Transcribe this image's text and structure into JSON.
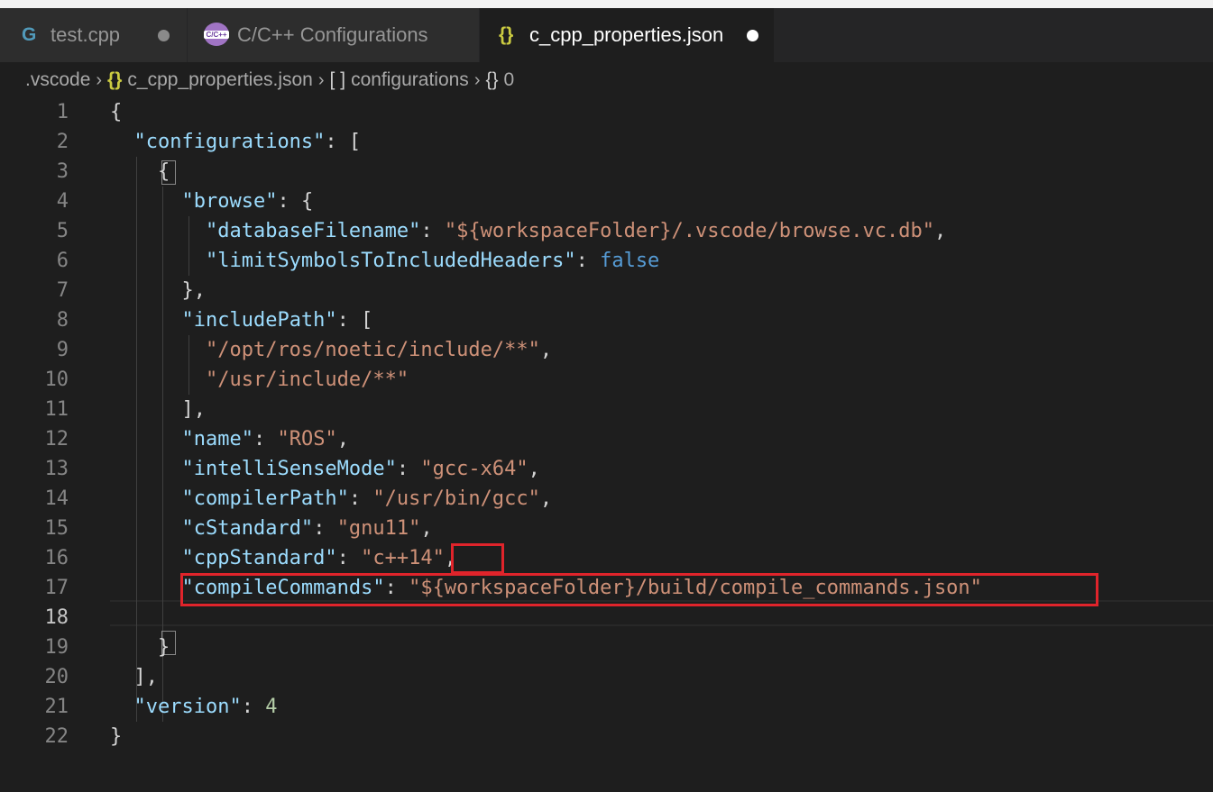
{
  "tabs": [
    {
      "label": "test.cpp",
      "icon": "cpp-file-icon",
      "modified": true,
      "active": false
    },
    {
      "label": "C/C++ Configurations",
      "icon": "cpp-config-icon",
      "icon_text": "C/C++",
      "modified": false,
      "active": false
    },
    {
      "label": "c_cpp_properties.json",
      "icon": "json-file-icon",
      "icon_text": "{}",
      "modified": true,
      "active": true
    }
  ],
  "breadcrumb": {
    "folder": ".vscode",
    "json_icon": "{}",
    "file": "c_cpp_properties.json",
    "array_icon": "[ ]",
    "array": "configurations",
    "object_icon": "{}",
    "object": "0"
  },
  "editor": {
    "active_line": 18,
    "lines": [
      {
        "n": "1",
        "t": [
          [
            "p",
            "{"
          ]
        ]
      },
      {
        "n": "2",
        "t": [
          [
            "p",
            "  "
          ],
          [
            "k",
            "\"configurations\""
          ],
          [
            "p",
            ": ["
          ]
        ]
      },
      {
        "n": "3",
        "t": [
          [
            "p",
            "    {"
          ]
        ]
      },
      {
        "n": "4",
        "t": [
          [
            "p",
            "      "
          ],
          [
            "k",
            "\"browse\""
          ],
          [
            "p",
            ": {"
          ]
        ]
      },
      {
        "n": "5",
        "t": [
          [
            "p",
            "        "
          ],
          [
            "k",
            "\"databaseFilename\""
          ],
          [
            "p",
            ": "
          ],
          [
            "s",
            "\"${workspaceFolder}/.vscode/browse.vc.db\""
          ],
          [
            "p",
            ","
          ]
        ]
      },
      {
        "n": "6",
        "t": [
          [
            "p",
            "        "
          ],
          [
            "k",
            "\"limitSymbolsToIncludedHeaders\""
          ],
          [
            "p",
            ": "
          ],
          [
            "b",
            "false"
          ]
        ]
      },
      {
        "n": "7",
        "t": [
          [
            "p",
            "      },"
          ]
        ]
      },
      {
        "n": "8",
        "t": [
          [
            "p",
            "      "
          ],
          [
            "k",
            "\"includePath\""
          ],
          [
            "p",
            ": ["
          ]
        ]
      },
      {
        "n": "9",
        "t": [
          [
            "p",
            "        "
          ],
          [
            "s",
            "\"/opt/ros/noetic/include/**\""
          ],
          [
            "p",
            ","
          ]
        ]
      },
      {
        "n": "10",
        "t": [
          [
            "p",
            "        "
          ],
          [
            "s",
            "\"/usr/include/**\""
          ]
        ]
      },
      {
        "n": "11",
        "t": [
          [
            "p",
            "      ],"
          ]
        ]
      },
      {
        "n": "12",
        "t": [
          [
            "p",
            "      "
          ],
          [
            "k",
            "\"name\""
          ],
          [
            "p",
            ": "
          ],
          [
            "s",
            "\"ROS\""
          ],
          [
            "p",
            ","
          ]
        ]
      },
      {
        "n": "13",
        "t": [
          [
            "p",
            "      "
          ],
          [
            "k",
            "\"intelliSenseMode\""
          ],
          [
            "p",
            ": "
          ],
          [
            "s",
            "\"gcc-x64\""
          ],
          [
            "p",
            ","
          ]
        ]
      },
      {
        "n": "14",
        "t": [
          [
            "p",
            "      "
          ],
          [
            "k",
            "\"compilerPath\""
          ],
          [
            "p",
            ": "
          ],
          [
            "s",
            "\"/usr/bin/gcc\""
          ],
          [
            "p",
            ","
          ]
        ]
      },
      {
        "n": "15",
        "t": [
          [
            "p",
            "      "
          ],
          [
            "k",
            "\"cStandard\""
          ],
          [
            "p",
            ": "
          ],
          [
            "s",
            "\"gnu11\""
          ],
          [
            "p",
            ","
          ]
        ]
      },
      {
        "n": "16",
        "t": [
          [
            "p",
            "      "
          ],
          [
            "k",
            "\"cppStandard\""
          ],
          [
            "p",
            ": "
          ],
          [
            "s",
            "\"c++14\""
          ],
          [
            "p",
            ","
          ]
        ]
      },
      {
        "n": "17",
        "t": [
          [
            "p",
            "      "
          ],
          [
            "k",
            "\"compileCommands\""
          ],
          [
            "p",
            ": "
          ],
          [
            "s",
            "\"${workspaceFolder}/build/compile_commands.json\""
          ]
        ]
      },
      {
        "n": "18",
        "t": [
          [
            "p",
            ""
          ]
        ]
      },
      {
        "n": "19",
        "t": [
          [
            "p",
            "    }"
          ]
        ]
      },
      {
        "n": "20",
        "t": [
          [
            "p",
            "  ],"
          ]
        ]
      },
      {
        "n": "21",
        "t": [
          [
            "p",
            "  "
          ],
          [
            "k",
            "\"version\""
          ],
          [
            "p",
            ": "
          ],
          [
            "n",
            "4"
          ]
        ]
      },
      {
        "n": "22",
        "t": [
          [
            "p",
            "}"
          ]
        ]
      }
    ]
  },
  "colors": {
    "background": "#1e1e1e",
    "key": "#9cdcfe",
    "string": "#ce9178",
    "number": "#b5cea8",
    "boolean": "#569cd6",
    "punctuation": "#d4d4d4",
    "annotation": "#e0242b"
  }
}
